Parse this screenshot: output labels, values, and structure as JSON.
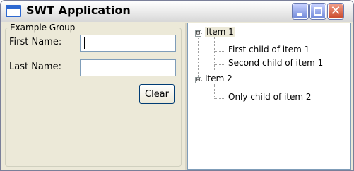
{
  "window": {
    "title": "SWT Application",
    "minimize_icon": "minimize-icon",
    "maximize_icon": "maximize-icon",
    "close_icon": "close-icon",
    "close_glyph": "✕",
    "accent_color": "#2d68d1",
    "close_color": "#c9482a"
  },
  "form": {
    "group_label": "Example Group",
    "first_name_label": "First Name:",
    "first_name_value": "",
    "last_name_label": "Last Name:",
    "last_name_value": "",
    "clear_label": "Clear"
  },
  "tree": {
    "items": [
      {
        "label": "Item 1",
        "expanded": true,
        "expander": "⊟",
        "children": [
          "First child of item 1",
          "Second child of item 1"
        ]
      },
      {
        "label": "Item 2",
        "expanded": true,
        "expander": "⊟",
        "children": [
          "Only child of item 2"
        ]
      }
    ]
  }
}
